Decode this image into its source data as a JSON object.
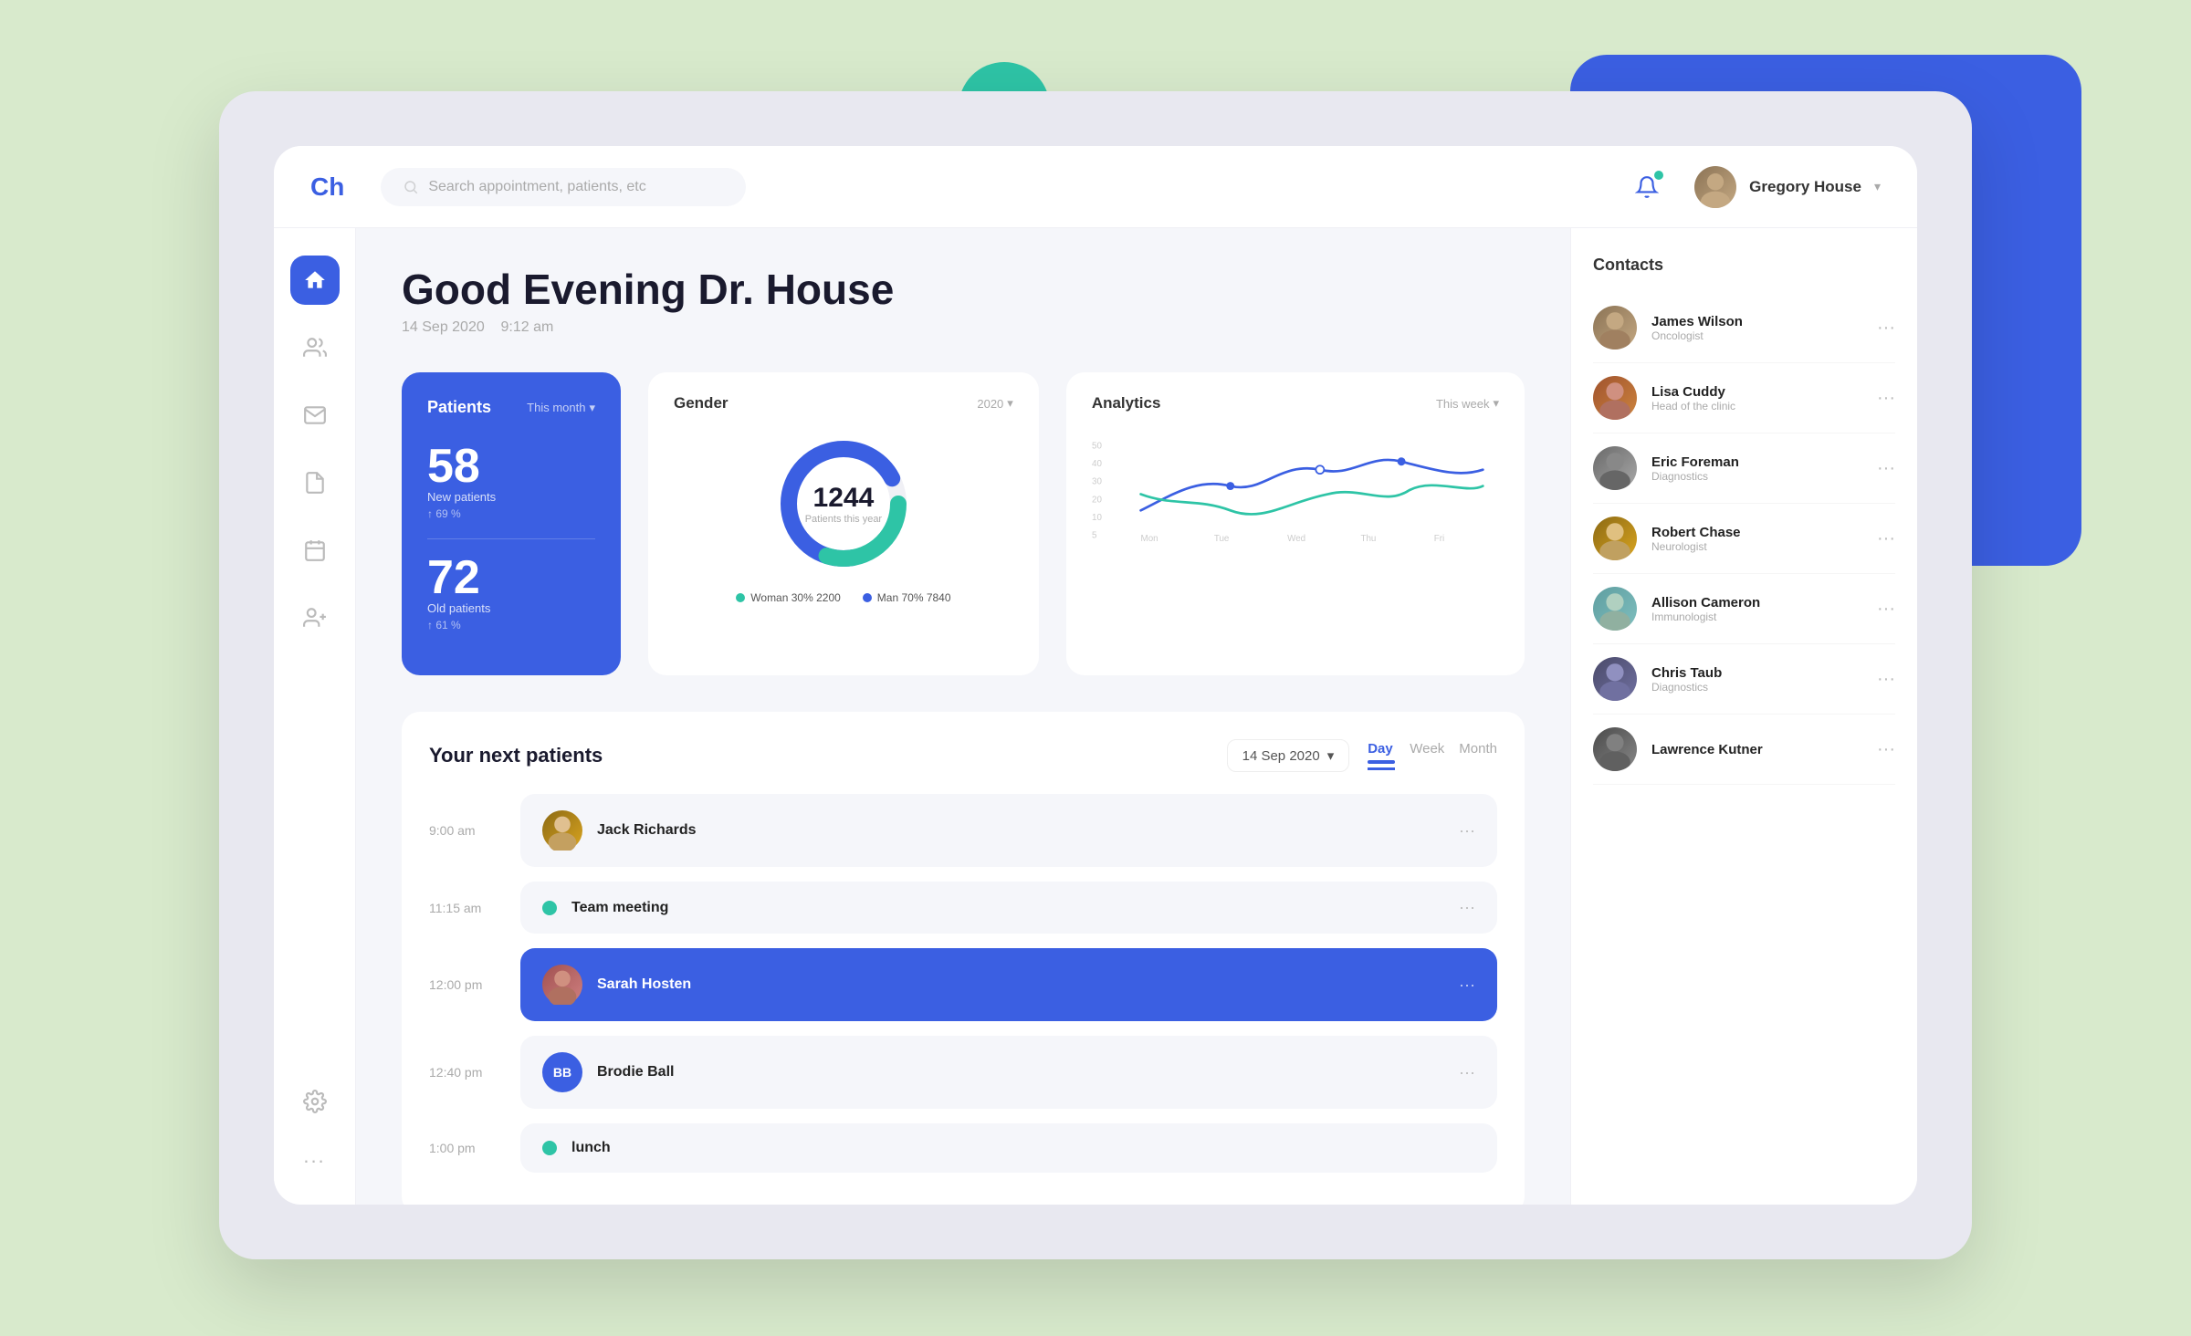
{
  "app": {
    "logo": "Ch",
    "bg_color": "#d8eacc"
  },
  "navbar": {
    "search_placeholder": "Search appointment, patients, etc",
    "user_name": "Gregory House",
    "notification_has_dot": true
  },
  "sidebar": {
    "items": [
      {
        "id": "home",
        "icon": "home-icon",
        "active": true
      },
      {
        "id": "users",
        "icon": "users-icon",
        "active": false
      },
      {
        "id": "mail",
        "icon": "mail-icon",
        "active": false
      },
      {
        "id": "document",
        "icon": "document-icon",
        "active": false
      },
      {
        "id": "calendar",
        "icon": "calendar-icon",
        "active": false
      },
      {
        "id": "person-plus",
        "icon": "person-plus-icon",
        "active": false
      },
      {
        "id": "settings",
        "icon": "settings-icon",
        "active": false
      }
    ],
    "more_label": "..."
  },
  "greeting": {
    "title": "Good Evening Dr. House",
    "date": "14 Sep 2020",
    "time": "9:12 am"
  },
  "patients_card": {
    "title": "Patients",
    "filter": "This month",
    "new_count": "58",
    "new_label": "New patients",
    "new_pct": "↑ 69 %",
    "old_count": "72",
    "old_label": "Old patients",
    "old_pct": "↑ 61 %"
  },
  "gender_card": {
    "title": "Gender",
    "filter": "2020",
    "center_number": "1244",
    "center_label": "Patients this year",
    "legend": [
      {
        "label": "Woman",
        "pct": "30%",
        "count": "2200",
        "color": "#2ec4a6"
      },
      {
        "label": "Man",
        "pct": "70%",
        "count": "7840",
        "color": "#3b5fe2"
      }
    ]
  },
  "analytics_card": {
    "title": "Analytics",
    "filter": "This week",
    "y_labels": [
      "50",
      "40",
      "30",
      "20",
      "10",
      "5"
    ],
    "x_labels": [
      "Mon",
      "Tue",
      "Wed",
      "Thu",
      "Fri"
    ]
  },
  "contacts": {
    "title": "Contacts",
    "items": [
      {
        "name": "James Wilson",
        "role": "Oncologist",
        "face_class": "face-1"
      },
      {
        "name": "Lisa Cuddy",
        "role": "Head of the clinic",
        "face_class": "face-2"
      },
      {
        "name": "Eric Foreman",
        "role": "Diagnostics",
        "face_class": "face-3"
      },
      {
        "name": "Robert Chase",
        "role": "Neurologist",
        "face_class": "face-4"
      },
      {
        "name": "Allison Cameron",
        "role": "Immunologist",
        "face_class": "face-5"
      },
      {
        "name": "Chris Taub",
        "role": "Diagnostics",
        "face_class": "face-6"
      },
      {
        "name": "Lawrence Kutner",
        "role": "",
        "face_class": "face-7"
      }
    ]
  },
  "schedule": {
    "title": "Your next patients",
    "date_selector": "14 Sep 2020",
    "view_buttons": [
      {
        "label": "Day",
        "active": true
      },
      {
        "label": "Week",
        "active": false
      },
      {
        "label": "Month",
        "active": false
      }
    ],
    "appointments": [
      {
        "time": "9:00 am",
        "name": "Jack Richards",
        "type": "person",
        "active": false
      },
      {
        "time": "11:15 am",
        "name": "Team meeting",
        "type": "green-dot",
        "active": false
      },
      {
        "time": "12:00 pm",
        "name": "Sarah Hosten",
        "type": "person",
        "active": true
      },
      {
        "time": "12:40 pm",
        "name": "Brodie Ball",
        "type": "initials",
        "initials": "BB",
        "active": false
      },
      {
        "time": "1:00 pm",
        "name": "lunch",
        "type": "green-dot",
        "active": false
      }
    ]
  }
}
